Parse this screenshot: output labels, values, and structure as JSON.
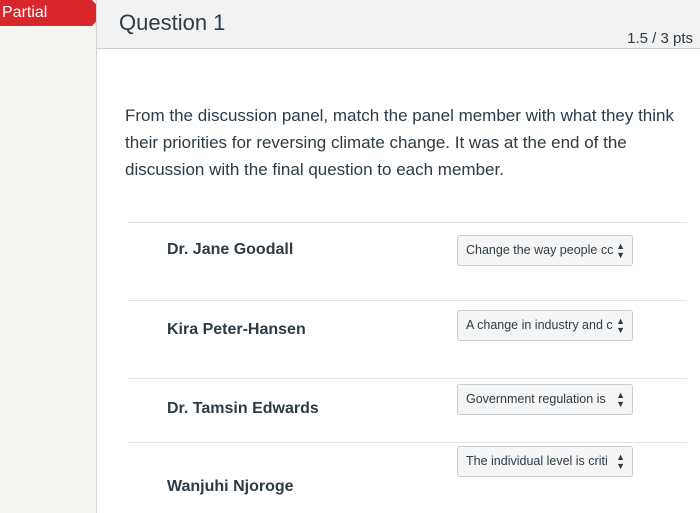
{
  "status_tag": "Partial",
  "question": {
    "title": "Question 1",
    "points": "1.5 / 3 pts",
    "prompt": "From the discussion panel, match the panel member with what they think their priorities for reversing climate change. It was at the end of the discussion with the final question to each member."
  },
  "matches": [
    {
      "member": "Dr. Jane Goodall",
      "answer": "Change the way people cc"
    },
    {
      "member": "Kira Peter-Hansen",
      "answer": "A change in industry and c"
    },
    {
      "member": "Dr. Tamsin Edwards",
      "answer": "Government regulation is"
    },
    {
      "member": "Wanjuhi Njoroge",
      "answer": "The individual level is criti"
    }
  ],
  "icons": {
    "select_arrows": "updown-chevron-icon"
  }
}
